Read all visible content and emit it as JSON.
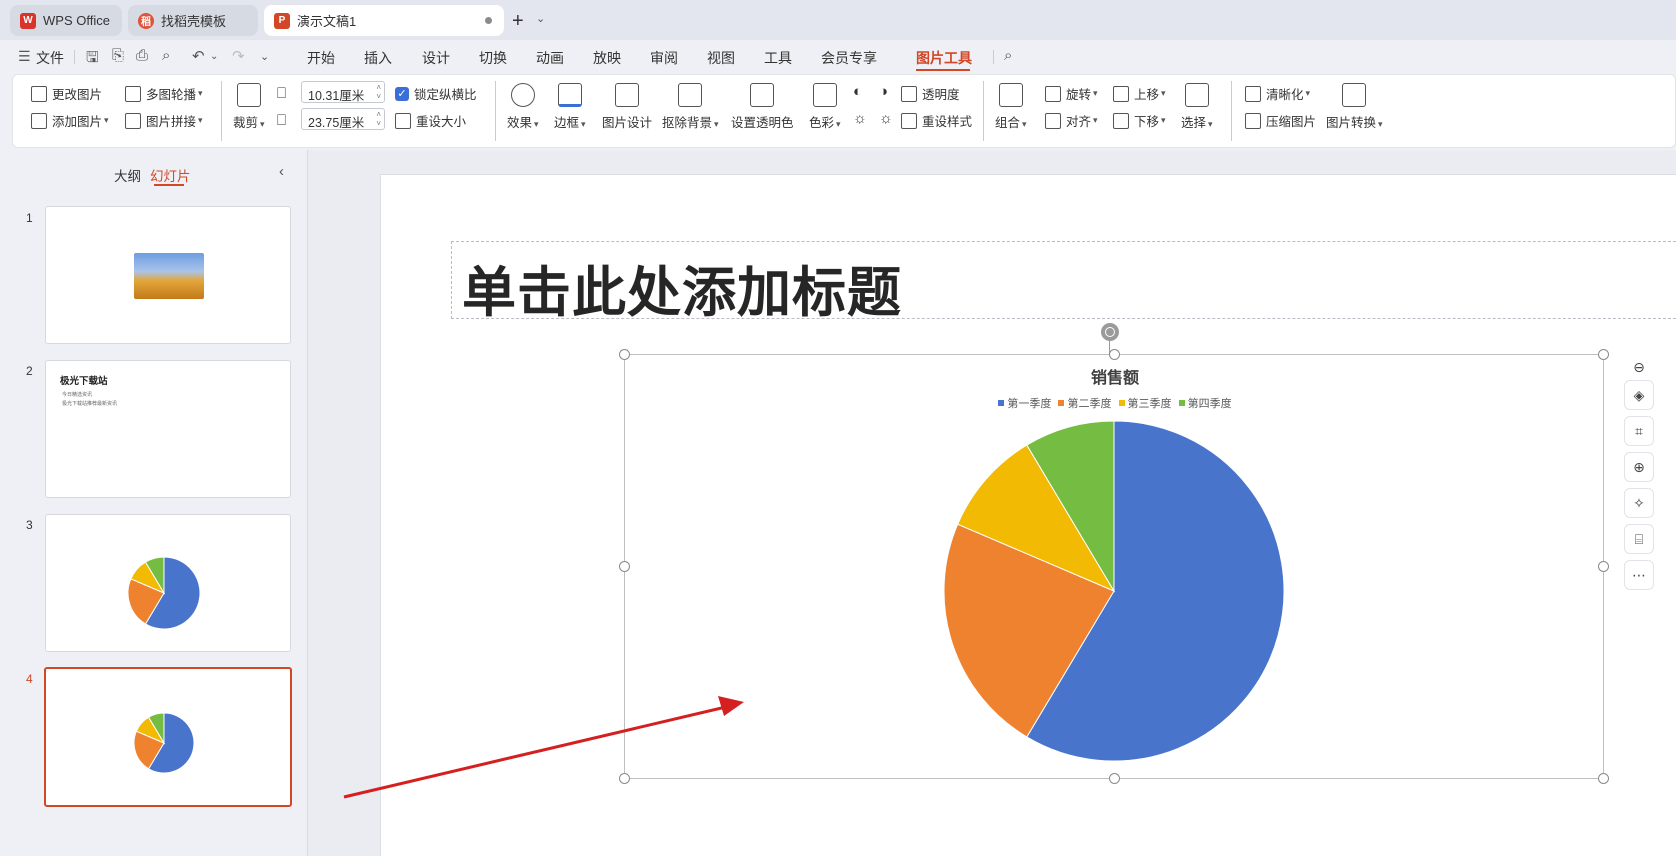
{
  "tabs": [
    {
      "label": "WPS Office",
      "logo": "W",
      "color": "#d9342b"
    },
    {
      "label": "找稻壳模板",
      "logo": "稻",
      "color": "#e0533b"
    },
    {
      "label": "演示文稿1",
      "logo": "P",
      "color": "#d24726"
    }
  ],
  "menu": {
    "file": "文件",
    "items": [
      "开始",
      "插入",
      "设计",
      "切换",
      "动画",
      "放映",
      "审阅",
      "视图",
      "工具",
      "会员专享",
      "图片工具"
    ],
    "active": "图片工具"
  },
  "ribbon": {
    "change_picture": "更改图片",
    "add_picture": "添加图片",
    "multi_carousel": "多图轮播",
    "picture_splice": "图片拼接",
    "crop": "裁剪",
    "width_value": "10.31厘米",
    "height_value": "23.75厘米",
    "lock_ratio": "锁定纵横比",
    "reset_size": "重设大小",
    "effects": "效果",
    "border": "边框",
    "picture_design": "图片设计",
    "remove_bg": "抠除背景",
    "set_transparent_color": "设置透明色",
    "color": "色彩",
    "transparency": "透明度",
    "reset_style": "重设样式",
    "group": "组合",
    "rotate": "旋转",
    "align": "对齐",
    "bring_forward": "上移",
    "send_backward": "下移",
    "select": "选择",
    "sharpen": "清晰化",
    "compress": "压缩图片",
    "convert": "图片转换"
  },
  "left_panel": {
    "outline_tab": "大纲",
    "slides_tab": "幻灯片",
    "slide_numbers": [
      "1",
      "2",
      "3",
      "4"
    ],
    "slide2_title": "极光下载站",
    "slide2_bullets": [
      "今日精选资讯",
      "极光下载站推荐最新资讯"
    ]
  },
  "slide": {
    "title_placeholder": "单击此处添加标题"
  },
  "chart_data": {
    "type": "pie",
    "title": "销售额",
    "categories": [
      "第一季度",
      "第二季度",
      "第三季度",
      "第四季度"
    ],
    "values": [
      8.2,
      3.2,
      1.4,
      1.2
    ],
    "colors": [
      "#4874cb",
      "#ee822f",
      "#f2ba02",
      "#75bd42"
    ],
    "legend_position": "top"
  },
  "icons": {
    "side_tools": [
      "minus-icon",
      "layers-icon",
      "crop-icon",
      "zoom-in-icon",
      "magic-icon",
      "ocr-icon",
      "more-icon"
    ]
  },
  "colors": {
    "accent": "#d24726",
    "selection": "#3a6fd8",
    "arrow": "#d42020"
  }
}
